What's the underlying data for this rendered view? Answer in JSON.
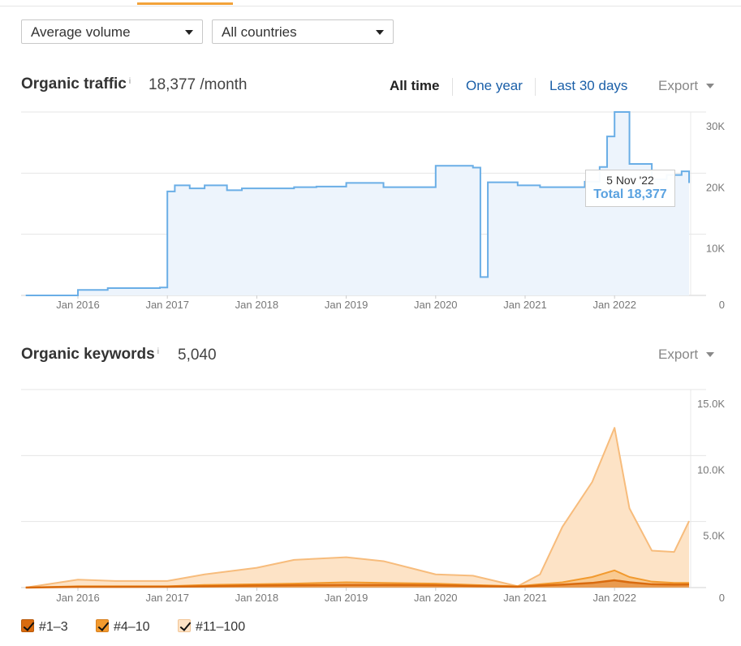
{
  "filters": {
    "volume_label": "Average volume",
    "country_label": "All countries"
  },
  "traffic": {
    "title": "Organic traffic",
    "info": "i",
    "value": "18,377 /month",
    "ranges": [
      "All time",
      "One year",
      "Last 30 days"
    ],
    "export_label": "Export",
    "tooltip": {
      "date": "5 Nov '22",
      "total": "Total 18,377"
    }
  },
  "keywords": {
    "title": "Organic keywords",
    "info": "i",
    "value": "5,040",
    "export_label": "Export"
  },
  "legend": [
    "#1–3",
    "#4–10",
    "#11–100"
  ],
  "colors": {
    "traffic_line": "#6aaee6",
    "traffic_fill": "#edf4fc",
    "link_blue": "#1a5fa8",
    "kw_11_100_fill": "#fde3c6",
    "kw_11_100_line": "#f7bc7c",
    "kw_4_10": "#f29a2e",
    "kw_1_3": "#d96b0f",
    "tab_accent": "#f2a23a"
  },
  "chart_data": [
    {
      "type": "area",
      "title": "Organic traffic",
      "x_tick_labels": [
        "Jan 2016",
        "Jan 2017",
        "Jan 2018",
        "Jan 2019",
        "Jan 2020",
        "Jan 2021",
        "Jan 2022"
      ],
      "y_tick_labels": [
        "30K",
        "20K",
        "10K",
        "0"
      ],
      "ylim": [
        0,
        30000
      ],
      "series": [
        {
          "x": [
            "2015-06",
            "2016-01",
            "2016-05",
            "2016-12",
            "2017-01",
            "2017-02",
            "2017-04",
            "2017-06",
            "2017-09",
            "2017-11",
            "2018-01",
            "2018-06",
            "2018-09",
            "2019-01",
            "2019-06",
            "2019-09",
            "2019-12",
            "2020-01",
            "2020-04",
            "2020-06",
            "2020-07",
            "2020-08",
            "2020-12",
            "2021-03",
            "2021-06",
            "2021-09",
            "2021-11",
            "2021-12",
            "2022-01",
            "2022-03",
            "2022-06",
            "2022-08",
            "2022-10",
            "2022-11"
          ],
          "values": [
            0,
            900,
            1200,
            1300,
            17000,
            18000,
            17500,
            18000,
            17200,
            17500,
            17500,
            17700,
            17800,
            18400,
            17700,
            17700,
            17700,
            21200,
            21200,
            20900,
            3000,
            18500,
            18000,
            17700,
            17700,
            18600,
            21000,
            26000,
            30000,
            21500,
            19000,
            19700,
            20300,
            18377
          ]
        }
      ]
    },
    {
      "type": "area",
      "title": "Organic keywords",
      "x_tick_labels": [
        "Jan 2016",
        "Jan 2017",
        "Jan 2018",
        "Jan 2019",
        "Jan 2020",
        "Jan 2021",
        "Jan 2022"
      ],
      "y_tick_labels": [
        "15.0K",
        "10.0K",
        "5.0K",
        "0"
      ],
      "ylim": [
        0,
        15000
      ],
      "x": [
        "2015-06",
        "2016-01",
        "2016-06",
        "2017-01",
        "2017-06",
        "2018-01",
        "2018-06",
        "2019-01",
        "2019-06",
        "2020-01",
        "2020-06",
        "2020-12",
        "2021-03",
        "2021-06",
        "2021-10",
        "2022-01",
        "2022-03",
        "2022-06",
        "2022-09",
        "2022-11"
      ],
      "series": [
        {
          "name": "#11–100",
          "values": [
            0,
            600,
            500,
            500,
            1000,
            1500,
            2100,
            2300,
            2000,
            1000,
            900,
            100,
            1000,
            4600,
            8000,
            12100,
            6000,
            2800,
            2700,
            5040
          ]
        },
        {
          "name": "#4–10",
          "values": [
            0,
            100,
            100,
            100,
            200,
            250,
            300,
            400,
            350,
            300,
            200,
            100,
            250,
            400,
            800,
            1300,
            800,
            450,
            350,
            350
          ]
        },
        {
          "name": "#1–3",
          "values": [
            0,
            50,
            50,
            60,
            100,
            150,
            180,
            200,
            200,
            180,
            120,
            60,
            150,
            220,
            350,
            550,
            400,
            250,
            220,
            230
          ]
        }
      ]
    }
  ]
}
